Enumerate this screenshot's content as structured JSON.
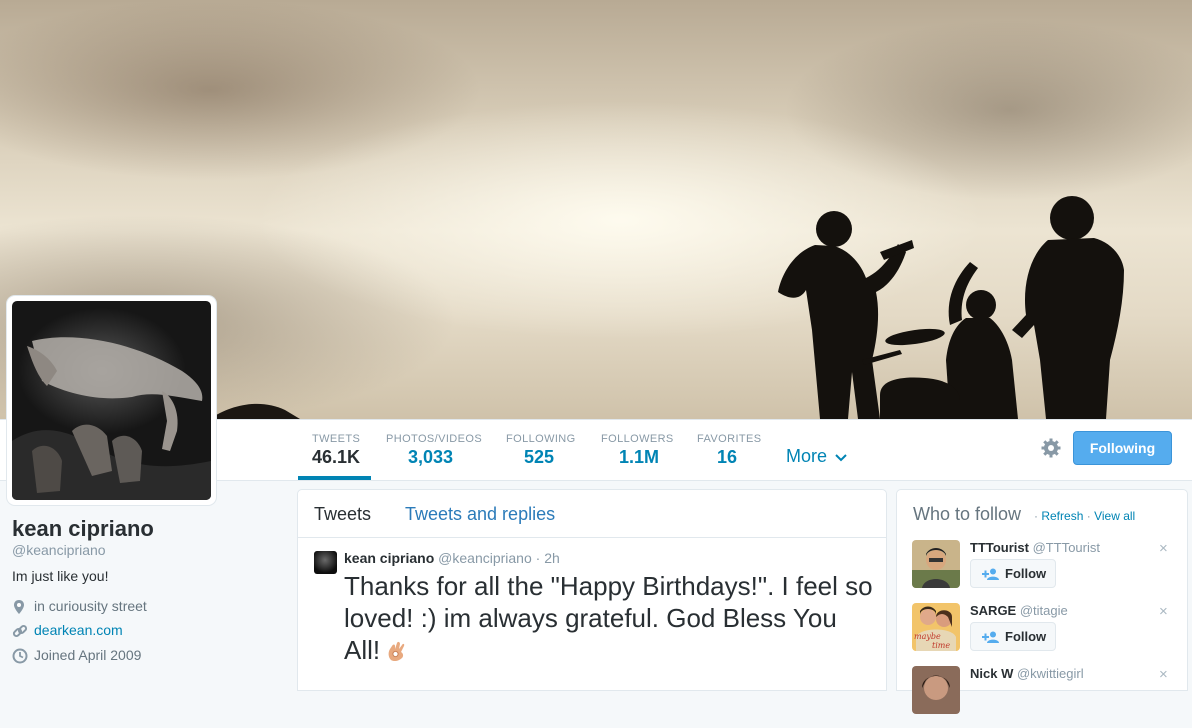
{
  "profile": {
    "name": "kean cipriano",
    "handle": "@keancipriano",
    "bio": "Im just like you!",
    "location": "in curiousity street",
    "website": "dearkean.com",
    "joined": "Joined April 2009"
  },
  "nav": {
    "stats": [
      {
        "label": "TWEETS",
        "value": "46.1K"
      },
      {
        "label": "PHOTOS/VIDEOS",
        "value": "3,033"
      },
      {
        "label": "FOLLOWING",
        "value": "525"
      },
      {
        "label": "FOLLOWERS",
        "value": "1.1M"
      },
      {
        "label": "FAVORITES",
        "value": "16"
      }
    ],
    "more_label": "More",
    "following_button": "Following",
    "icons": {
      "settings": "gear-icon",
      "more": "chevron-down-icon"
    }
  },
  "timeline": {
    "tabs": [
      "Tweets",
      "Tweets and replies"
    ],
    "tweet": {
      "name": "kean cipriano",
      "handle": "@keancipriano",
      "sep": "·",
      "time": "2h",
      "text": "Thanks for all the \"Happy Birthdays!\". I feel so loved! :) im always grateful. God Bless You All!",
      "emoji": "ok-hand-emoji"
    }
  },
  "who_to_follow": {
    "title": "Who to follow",
    "sep": "·",
    "refresh": "Refresh",
    "view_all": "View all",
    "follow_label": "Follow",
    "close_glyph": "×",
    "suggestions": [
      {
        "name": "TTTourist",
        "handle": "@TTTourist"
      },
      {
        "name": "SARGE",
        "handle": "@titagie"
      },
      {
        "name": "Nick W",
        "handle": "@kwittiegirl"
      }
    ],
    "avatar_texts": {
      "sarge_a": "maybe",
      "sarge_b": "time"
    }
  },
  "colors": {
    "accent": "#0084b4",
    "button_blue": "#55acee",
    "muted": "#8899a6"
  }
}
